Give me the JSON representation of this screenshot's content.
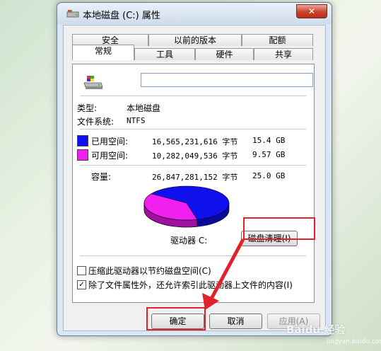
{
  "window": {
    "title": "本地磁盘 (C:) 属性",
    "close_label": "✕"
  },
  "tabs_row1": [
    "安全",
    "以前的版本",
    "配额"
  ],
  "tabs_row2": [
    "常规",
    "工具",
    "硬件",
    "共享"
  ],
  "general": {
    "name_value": "",
    "type_label": "类型:",
    "type_value": "本地磁盘",
    "fs_label": "文件系统:",
    "fs_value": "NTFS",
    "used_label": "已用空间:",
    "used_bytes": "16,565,231,616 字节",
    "used_size": "15.4 GB",
    "free_label": "可用空间:",
    "free_bytes": "10,282,049,536 字节",
    "free_size": "9.57 GB",
    "capacity_label": "容量:",
    "capacity_bytes": "26,847,281,152 字节",
    "capacity_size": "25.0 GB",
    "drive_label": "驱动器 C:",
    "cleanup_button": "磁盘清理(I)",
    "compress_label": "压缩此驱动器以节约磁盘空间(C)",
    "index_label": "除了文件属性外，还允许索引此驱动器上文件的内容(I)",
    "compress_checked": false,
    "index_checked": true,
    "index_check_mark": "✓",
    "used_fraction": 0.617,
    "free_fraction": 0.383
  },
  "buttons": {
    "ok": "确定",
    "cancel": "取消",
    "apply": "应用(A)"
  },
  "colors": {
    "used": "#1010ee",
    "free": "#f020f0",
    "highlight": "#e0222a"
  },
  "watermark": {
    "main": "Baidu 经验",
    "sub": "jingyan.baidu.com"
  }
}
